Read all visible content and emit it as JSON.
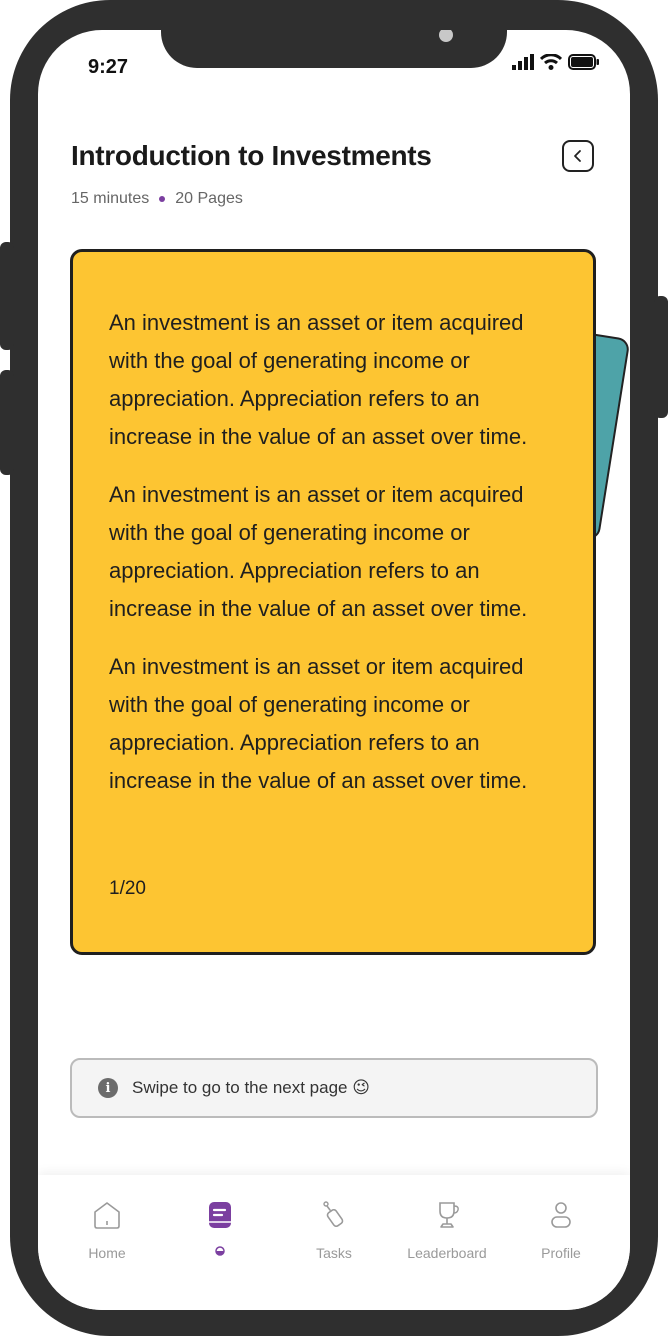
{
  "status_bar": {
    "time": "9:27"
  },
  "lesson": {
    "title": "Introduction to Investments",
    "duration": "15 minutes",
    "pages": "20 Pages"
  },
  "card": {
    "paragraphs": [
      "An investment is an asset or item acquired with the goal of generating income or appreciation. Appreciation refers to an increase in the value of an asset over time.",
      "An investment is an asset or item acquired with the goal of generating income or appreciation. Appreciation refers to an increase in the value of an asset over time.",
      "An investment is an asset or item acquired with the goal of generating income or appreciation. Appreciation refers to an increase in the value of an asset over time."
    ],
    "page_indicator": "1/20",
    "color": "#fdc532",
    "back_card_color": "#4ea3a8"
  },
  "hint": {
    "text": "Swipe to go to the next page",
    "emoji": "😉"
  },
  "nav": {
    "home": "Home",
    "learn": "",
    "tasks": "Tasks",
    "leaderboard": "Leaderboard",
    "profile": "Profile",
    "active_color": "#7b3fa0"
  }
}
